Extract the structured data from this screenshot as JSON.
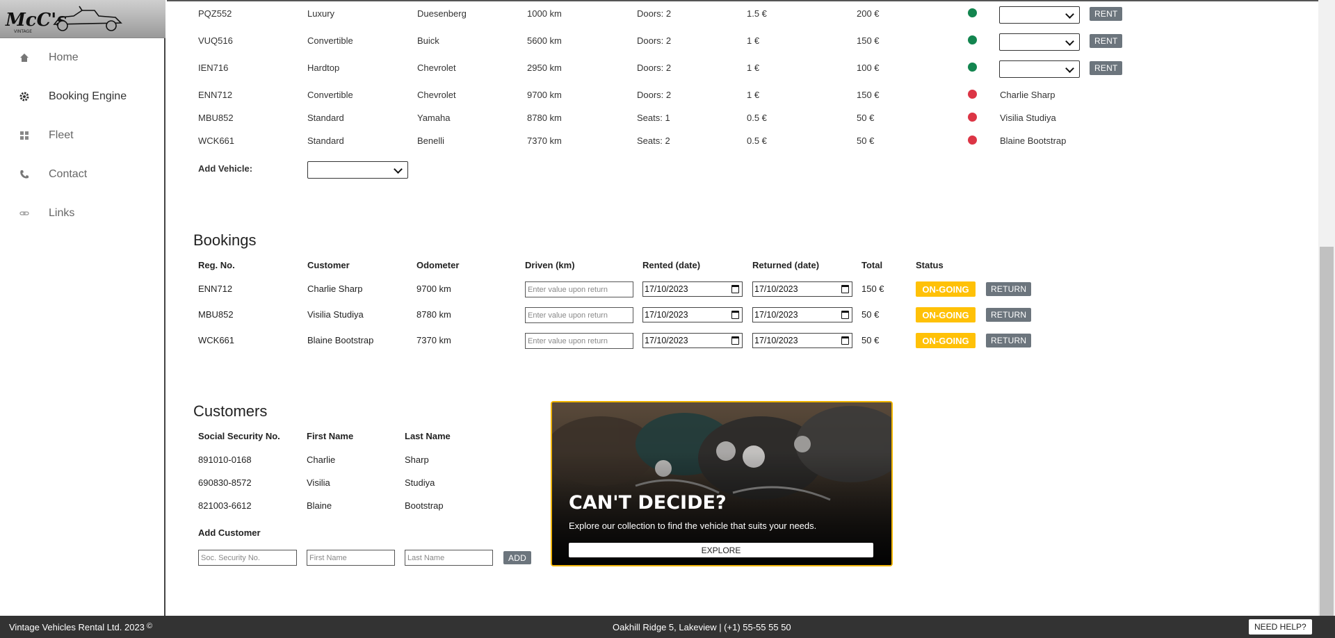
{
  "nav": {
    "items": [
      {
        "label": "Home",
        "icon": "home-icon"
      },
      {
        "label": "Booking Engine",
        "icon": "gear-icon"
      },
      {
        "label": "Fleet",
        "icon": "grid-icon"
      },
      {
        "label": "Contact",
        "icon": "phone-icon"
      },
      {
        "label": "Links",
        "icon": "link-icon"
      }
    ]
  },
  "vehicles": {
    "rows": [
      {
        "reg": "PQZ552",
        "type": "Luxury",
        "make": "Duesenberg",
        "odometer": "1000 km",
        "capacity": "Doors: 2",
        "rate": "1.5 €",
        "price": "200 €",
        "status": "available",
        "renter": ""
      },
      {
        "reg": "VUQ516",
        "type": "Convertible",
        "make": "Buick",
        "odometer": "5600 km",
        "capacity": "Doors: 2",
        "rate": "1 €",
        "price": "150 €",
        "status": "available",
        "renter": ""
      },
      {
        "reg": "IEN716",
        "type": "Hardtop",
        "make": "Chevrolet",
        "odometer": "2950 km",
        "capacity": "Doors: 2",
        "rate": "1 €",
        "price": "100 €",
        "status": "available",
        "renter": ""
      },
      {
        "reg": "ENN712",
        "type": "Convertible",
        "make": "Chevrolet",
        "odometer": "9700 km",
        "capacity": "Doors: 2",
        "rate": "1 €",
        "price": "150 €",
        "status": "rented",
        "renter": "Charlie Sharp"
      },
      {
        "reg": "MBU852",
        "type": "Standard",
        "make": "Yamaha",
        "odometer": "8780 km",
        "capacity": "Seats: 1",
        "rate": "0.5 €",
        "price": "50 €",
        "status": "rented",
        "renter": "Visilia Studiya"
      },
      {
        "reg": "WCK661",
        "type": "Standard",
        "make": "Benelli",
        "odometer": "7370 km",
        "capacity": "Seats: 2",
        "rate": "0.5 €",
        "price": "50 €",
        "status": "rented",
        "renter": "Blaine Bootstrap"
      }
    ],
    "rent_label": "RENT",
    "add_vehicle_label": "Add Vehicle:",
    "status_colors": {
      "available": "#13854f",
      "rented": "#dc3545"
    }
  },
  "bookings": {
    "title": "Bookings",
    "headers": [
      "Reg. No.",
      "Customer",
      "Odometer",
      "Driven (km)",
      "Rented (date)",
      "Returned (date)",
      "Total",
      "Status"
    ],
    "rows": [
      {
        "reg": "ENN712",
        "customer": "Charlie Sharp",
        "odometer": "9700 km",
        "driven_placeholder": "Enter value upon return",
        "rented": "17/10/2023",
        "returned": "17/10/2023",
        "total": "150 €",
        "status": "ON-GOING"
      },
      {
        "reg": "MBU852",
        "customer": "Visilia Studiya",
        "odometer": "8780 km",
        "driven_placeholder": "Enter value upon return",
        "rented": "17/10/2023",
        "returned": "17/10/2023",
        "total": "50 €",
        "status": "ON-GOING"
      },
      {
        "reg": "WCK661",
        "customer": "Blaine Bootstrap",
        "odometer": "7370 km",
        "driven_placeholder": "Enter value upon return",
        "rented": "17/10/2023",
        "returned": "17/10/2023",
        "total": "50 €",
        "status": "ON-GOING"
      }
    ],
    "return_label": "RETURN",
    "status_color": "#ffc107"
  },
  "customers": {
    "title": "Customers",
    "headers": [
      "Social Security No.",
      "First Name",
      "Last Name"
    ],
    "rows": [
      {
        "ssn": "891010-0168",
        "first": "Charlie",
        "last": "Sharp"
      },
      {
        "ssn": "690830-8572",
        "first": "Visilia",
        "last": "Studiya"
      },
      {
        "ssn": "821003-6612",
        "first": "Blaine",
        "last": "Bootstrap"
      }
    ],
    "add_title": "Add Customer",
    "placeholders": {
      "ssn": "Soc. Security No.",
      "first": "First Name",
      "last": "Last Name"
    },
    "add_label": "ADD"
  },
  "promo": {
    "title": "CAN'T DECIDE?",
    "text": "Explore our collection to find the vehicle that suits your needs.",
    "button": "EXPLORE",
    "border_color": "#f0b400"
  },
  "footer": {
    "copyright": "Vintage Vehicles Rental Ltd. 2023",
    "copyright_icon": "copyright-icon",
    "address": "Oakhill Ridge 5, Lakeview | (+1) 55-55 55 50",
    "help": "NEED HELP?"
  }
}
